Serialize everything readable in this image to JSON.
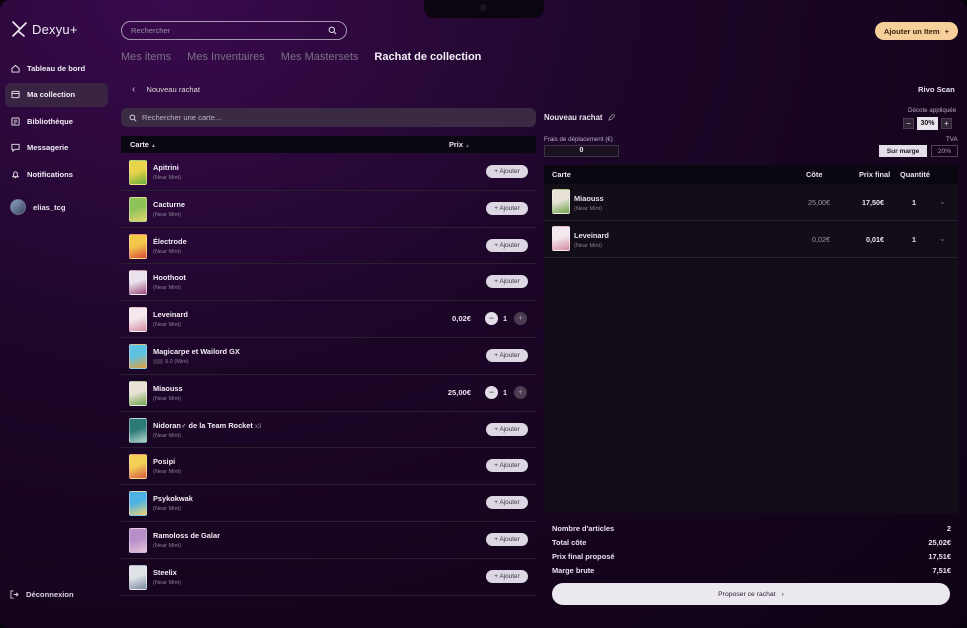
{
  "app": {
    "name": "Dexyu+"
  },
  "sidebar": {
    "items": [
      {
        "label": "Tableau de bord",
        "icon": "home-icon",
        "active": false
      },
      {
        "label": "Ma collection",
        "icon": "collection-icon",
        "active": true
      },
      {
        "label": "Bibliothèque",
        "icon": "library-icon",
        "active": false
      },
      {
        "label": "Messagerie",
        "icon": "message-icon",
        "active": false
      },
      {
        "label": "Notifications",
        "icon": "bell-icon",
        "active": false
      }
    ],
    "user": "elias_tcg",
    "logout": "Déconnexion"
  },
  "header": {
    "search_placeholder": "Rechercher",
    "add_item": "Ajouter un Item",
    "tabs": [
      {
        "label": "Mes items",
        "active": false
      },
      {
        "label": "Mes Inventaires",
        "active": false
      },
      {
        "label": "Mes Mastersets",
        "active": false
      },
      {
        "label": "Rachat de collection",
        "active": true
      }
    ]
  },
  "left": {
    "back_label": "Nouveau rachat",
    "card_search_placeholder": "Rechercher une carte...",
    "col_card": "Carte",
    "col_price": "Prix",
    "add_label": "+ Ajouter",
    "cards": [
      {
        "name": "Apitrini",
        "cond": "(Near Mint)",
        "colors": [
          "#e8d44a",
          "#6cae3e"
        ],
        "state": "add"
      },
      {
        "name": "Cacturne",
        "cond": "(Near Mint)",
        "colors": [
          "#8fc35a",
          "#e6d56e"
        ],
        "state": "add"
      },
      {
        "name": "Électrode",
        "cond": "(Near Mint)",
        "colors": [
          "#f2c94a",
          "#d9493b"
        ],
        "state": "add"
      },
      {
        "name": "Hoothoot",
        "cond": "(Near Mint)",
        "colors": [
          "#e9e2ec",
          "#9a4a78"
        ],
        "state": "add"
      },
      {
        "name": "Leveinard",
        "cond": "(Near Mint)",
        "colors": [
          "#f2e8ee",
          "#d58aa3"
        ],
        "state": "selected",
        "price": "0,02€",
        "qty": "1"
      },
      {
        "name": "Magicarpe et Wailord GX",
        "cond": "9.0 (Mint)",
        "graded": true,
        "colors": [
          "#5ec2e3",
          "#e4a23e"
        ],
        "state": "add"
      },
      {
        "name": "Miaouss",
        "cond": "(Near Mint)",
        "colors": [
          "#e8e2d6",
          "#6ea54c"
        ],
        "state": "selected",
        "price": "25,00€",
        "qty": "1"
      },
      {
        "name": "Nidoran♂ de la Team Rocket",
        "qty_tag": "x3",
        "cond": "(Near Mint)",
        "colors": [
          "#2c7a76",
          "#b6d6cf"
        ],
        "state": "add"
      },
      {
        "name": "Posipi",
        "cond": "(Near Mint)",
        "colors": [
          "#f3d055",
          "#d85b45"
        ],
        "state": "add"
      },
      {
        "name": "Psykokwak",
        "cond": "(Near Mint)",
        "colors": [
          "#4db1e3",
          "#f1d271"
        ],
        "state": "add"
      },
      {
        "name": "Ramoloss de Galar",
        "cond": "(Near Mint)",
        "colors": [
          "#b88ec9",
          "#e5c6d8"
        ],
        "state": "add"
      },
      {
        "name": "Steelix",
        "cond": "(Near Mint)",
        "colors": [
          "#dfe3e8",
          "#7d8aa0"
        ],
        "state": "add"
      }
    ]
  },
  "right": {
    "rivo": "Rivo Scan",
    "title": "Nouveau rachat",
    "decote_label": "Décote appliquée",
    "decote_value": "30%",
    "frais_label": "Frais de déplacement (€)",
    "frais_value": "0",
    "tva_label": "TVA",
    "marge_btn": "Sur marge",
    "tva_btn": "20%",
    "cols": {
      "card": "Carte",
      "cote": "Côte",
      "final": "Prix final",
      "qty": "Quantité"
    },
    "rows": [
      {
        "name": "Miaouss",
        "cond": "(Near Mint)",
        "cote": "25,00€",
        "final": "17,50€",
        "qty": "1",
        "colors": [
          "#e8e2d6",
          "#6ea54c"
        ]
      },
      {
        "name": "Leveinard",
        "cond": "(Near Mint)",
        "cote": "0,02€",
        "final": "0,01€",
        "qty": "1",
        "colors": [
          "#f2e8ee",
          "#d58aa3"
        ]
      }
    ],
    "summary": [
      {
        "label": "Nombre d'articles",
        "value": "2"
      },
      {
        "label": "Total côte",
        "value": "25,02€"
      },
      {
        "label": "Prix final proposé",
        "value": "17,51€"
      },
      {
        "label": "Marge brute",
        "value": "7,51€"
      }
    ],
    "propose_btn": "Proposer ce rachat"
  }
}
